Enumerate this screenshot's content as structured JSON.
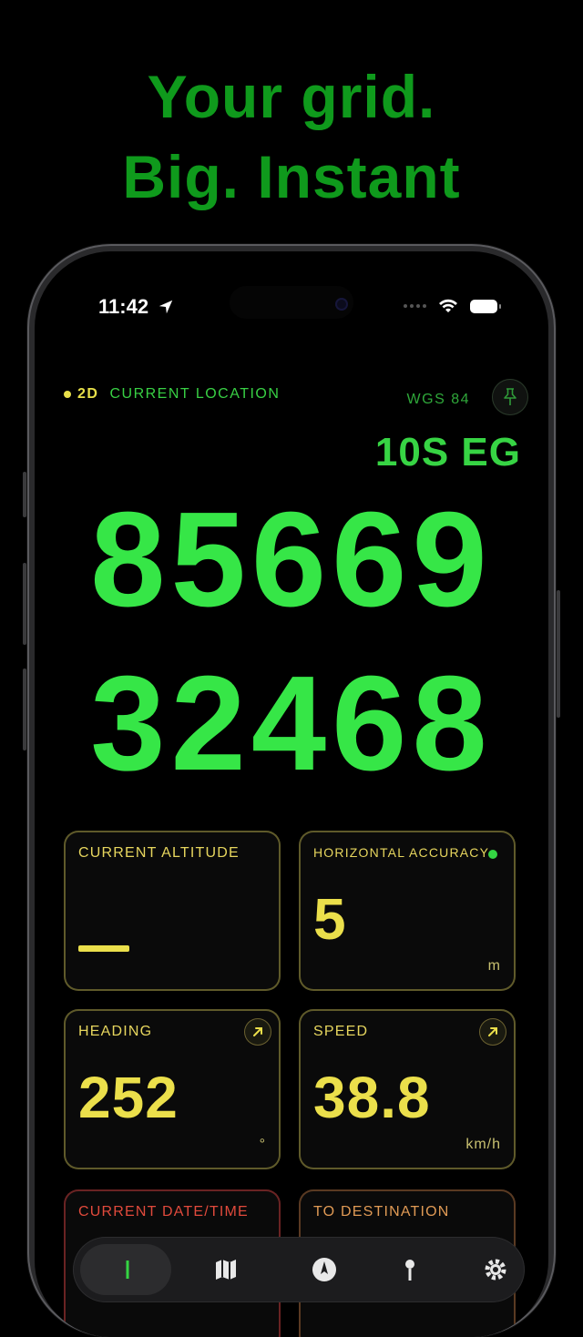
{
  "headline": {
    "line1": "Your grid.",
    "line2": "Big. Instant"
  },
  "status_bar": {
    "time": "11:42"
  },
  "location": {
    "mode": "2D",
    "label": "CURRENT LOCATION",
    "datum": "WGS 84",
    "grid_zone": "10S EG",
    "easting": "85669",
    "northing": "32468"
  },
  "cards": {
    "altitude": {
      "label": "CURRENT ALTITUDE",
      "value": ""
    },
    "accuracy": {
      "label": "HORIZONTAL ACCURACY",
      "value": "5",
      "unit": "m"
    },
    "heading": {
      "label": "HEADING",
      "value": "252",
      "unit": "°"
    },
    "speed": {
      "label": "SPEED",
      "value": "38.8",
      "unit": "km/h"
    },
    "datetime": {
      "label": "CURRENT DATE/TIME"
    },
    "destination": {
      "label": "TO DESTINATION"
    }
  },
  "colors": {
    "accent_green": "#36e647",
    "headline_green": "#0f9a1c",
    "value_yellow": "#ebdf4b",
    "alert_red": "#e14a3c"
  },
  "tabs": [
    "grid-icon",
    "map-icon",
    "compass-icon",
    "waypoint-icon",
    "settings-icon"
  ]
}
